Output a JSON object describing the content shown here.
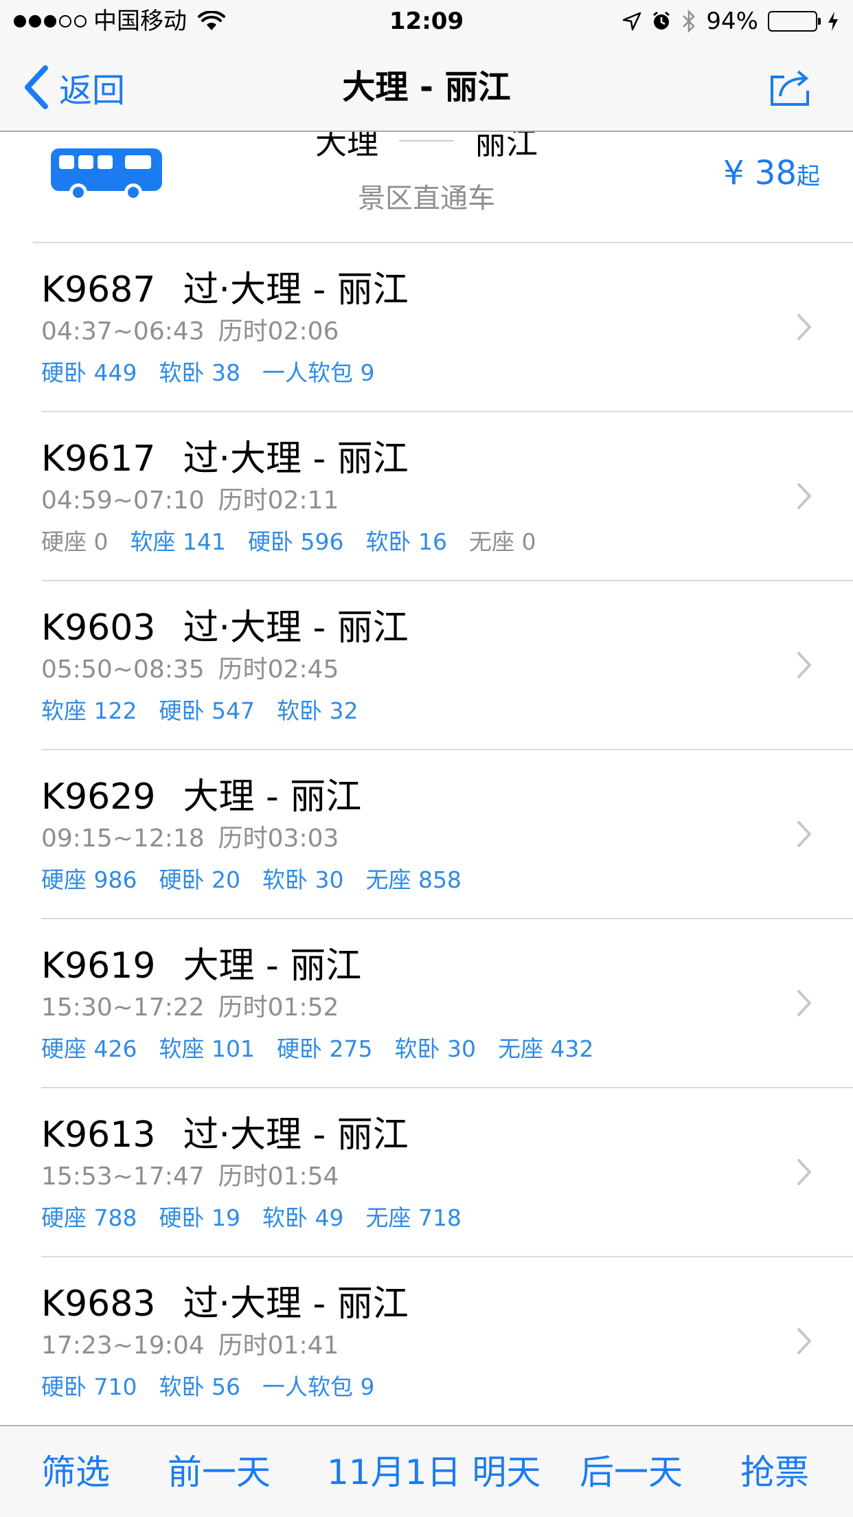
{
  "status_bar": {
    "carrier": "中国移动",
    "time": "12:09",
    "battery_percent": "94%",
    "battery_level": 0.94,
    "signal_bars": 3,
    "signal_total": 5
  },
  "nav": {
    "back_label": "返回",
    "title": "大理 - 丽江"
  },
  "bus_card": {
    "from": "大理",
    "to": "丽江",
    "subtitle": "景区直通车",
    "price": "¥ 38",
    "price_suffix": "起"
  },
  "trains": [
    {
      "code": "K9687",
      "route": "过·大理 - 丽江",
      "time": "04:37~06:43",
      "duration": "历时02:06",
      "seats": [
        {
          "label": "硬卧 449",
          "available": true
        },
        {
          "label": "软卧 38",
          "available": true
        },
        {
          "label": "一人软包 9",
          "available": true
        }
      ]
    },
    {
      "code": "K9617",
      "route": "过·大理 - 丽江",
      "time": "04:59~07:10",
      "duration": "历时02:11",
      "seats": [
        {
          "label": "硬座 0",
          "available": false
        },
        {
          "label": "软座 141",
          "available": true
        },
        {
          "label": "硬卧 596",
          "available": true
        },
        {
          "label": "软卧 16",
          "available": true
        },
        {
          "label": "无座 0",
          "available": false
        }
      ]
    },
    {
      "code": "K9603",
      "route": "过·大理 - 丽江",
      "time": "05:50~08:35",
      "duration": "历时02:45",
      "seats": [
        {
          "label": "软座 122",
          "available": true
        },
        {
          "label": "硬卧 547",
          "available": true
        },
        {
          "label": "软卧 32",
          "available": true
        }
      ]
    },
    {
      "code": "K9629",
      "route": "大理 - 丽江",
      "time": "09:15~12:18",
      "duration": "历时03:03",
      "seats": [
        {
          "label": "硬座 986",
          "available": true
        },
        {
          "label": "硬卧 20",
          "available": true
        },
        {
          "label": "软卧 30",
          "available": true
        },
        {
          "label": "无座 858",
          "available": true
        }
      ]
    },
    {
      "code": "K9619",
      "route": "大理 - 丽江",
      "time": "15:30~17:22",
      "duration": "历时01:52",
      "seats": [
        {
          "label": "硬座 426",
          "available": true
        },
        {
          "label": "软座 101",
          "available": true
        },
        {
          "label": "硬卧 275",
          "available": true
        },
        {
          "label": "软卧 30",
          "available": true
        },
        {
          "label": "无座 432",
          "available": true
        }
      ]
    },
    {
      "code": "K9613",
      "route": "过·大理 - 丽江",
      "time": "15:53~17:47",
      "duration": "历时01:54",
      "seats": [
        {
          "label": "硬座 788",
          "available": true
        },
        {
          "label": "硬卧 19",
          "available": true
        },
        {
          "label": "软卧 49",
          "available": true
        },
        {
          "label": "无座 718",
          "available": true
        }
      ]
    },
    {
      "code": "K9683",
      "route": "过·大理 - 丽江",
      "time": "17:23~19:04",
      "duration": "历时01:41",
      "seats": [
        {
          "label": "硬卧 710",
          "available": true
        },
        {
          "label": "软卧 56",
          "available": true
        },
        {
          "label": "一人软包 9",
          "available": true
        }
      ]
    }
  ],
  "toolbar": {
    "filter": "筛选",
    "prev_day": "前一天",
    "current_date": "11月1日 明天",
    "next_day": "后一天",
    "grab_ticket": "抢票"
  },
  "colors": {
    "accent": "#1a7cf0",
    "seat_available": "#2f8be6",
    "seat_unavailable": "#8e8e93",
    "battery": "#4cd964"
  }
}
